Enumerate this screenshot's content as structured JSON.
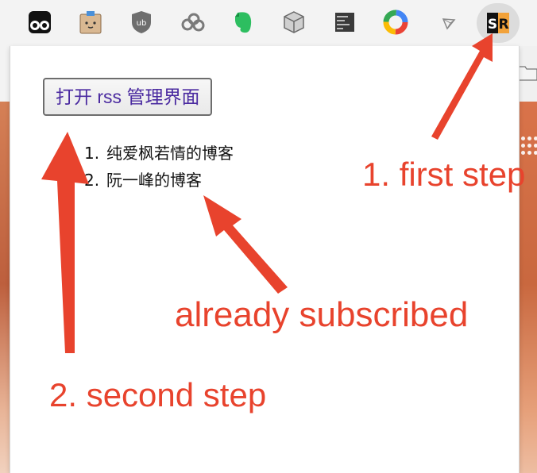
{
  "toolbar": {
    "extensions": [
      {
        "icon": "tampermonkey-icon"
      },
      {
        "icon": "box-face-icon"
      },
      {
        "icon": "ublock-icon"
      },
      {
        "icon": "cloud-icon"
      },
      {
        "icon": "evernote-icon"
      },
      {
        "icon": "cube-icon"
      },
      {
        "icon": "terminal-icon"
      },
      {
        "icon": "color-ring-icon"
      },
      {
        "icon": "triangle-icon"
      },
      {
        "icon": "sr-icon",
        "label": "SR"
      }
    ]
  },
  "popup": {
    "open_button_label": "打开 rss 管理界面",
    "subscriptions": [
      {
        "number": "1.",
        "title": "纯爱枫若情的博客"
      },
      {
        "number": "2.",
        "title": "阮一峰的博客"
      }
    ]
  },
  "annotations": {
    "first_step": "1. first step",
    "already_subscribed": "already subscribed",
    "second_step": "2. second step"
  },
  "colors": {
    "annotation": "#e8432d",
    "button_text": "#4a2aa0"
  }
}
